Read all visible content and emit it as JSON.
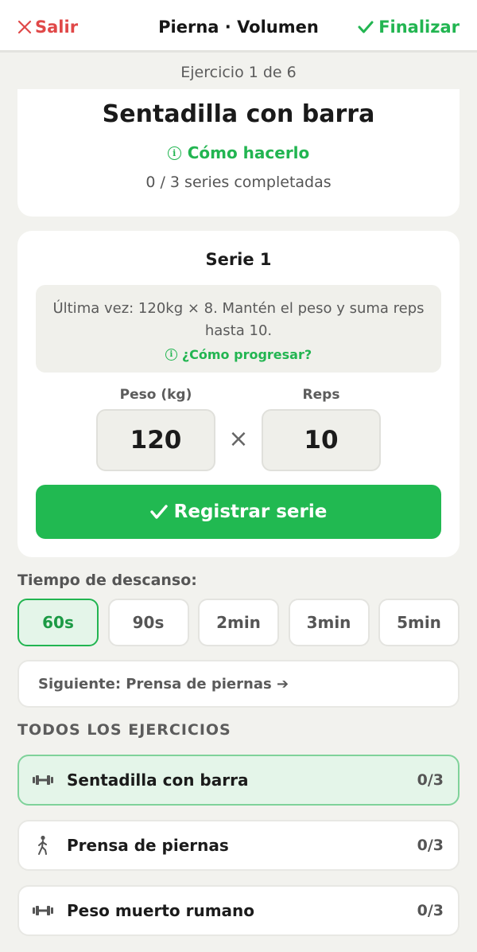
{
  "header": {
    "exit_label": "Salir",
    "title": "Pierna · Volumen",
    "finish_label": "Finalizar"
  },
  "progress_label": "Ejercicio 1 de 6",
  "exercise": {
    "name": "Sentadilla con barra",
    "howto_label": "Cómo hacerlo",
    "sets_status": "0 / 3 series completadas"
  },
  "set": {
    "title": "Serie 1",
    "hint": "Última vez: 120kg × 8. Mantén el peso y suma reps hasta 10.",
    "progress_link": "¿Cómo progresar?",
    "weight_label": "Peso (kg)",
    "weight_value": "120",
    "times_symbol": "×",
    "reps_label": "Reps",
    "reps_value": "10",
    "register_label": "Registrar serie"
  },
  "rest": {
    "label": "Tiempo de descanso:",
    "options": [
      "60s",
      "90s",
      "2min",
      "3min",
      "5min"
    ],
    "selected": "60s"
  },
  "next_label": "Siguiente: Prensa de piernas ➔",
  "all_exercises": {
    "title": "TODOS LOS EJERCICIOS",
    "items": [
      {
        "name": "Sentadilla con barra",
        "count": "0/3",
        "icon": "dumbbell-icon",
        "active": true
      },
      {
        "name": "Prensa de piernas",
        "count": "0/3",
        "icon": "walking-person-icon",
        "active": false
      },
      {
        "name": "Peso muerto rumano",
        "count": "0/3",
        "icon": "dumbbell-icon",
        "active": false
      }
    ]
  },
  "colors": {
    "accent": "#22b551",
    "danger": "#e04848",
    "background": "#f2f2ee"
  }
}
